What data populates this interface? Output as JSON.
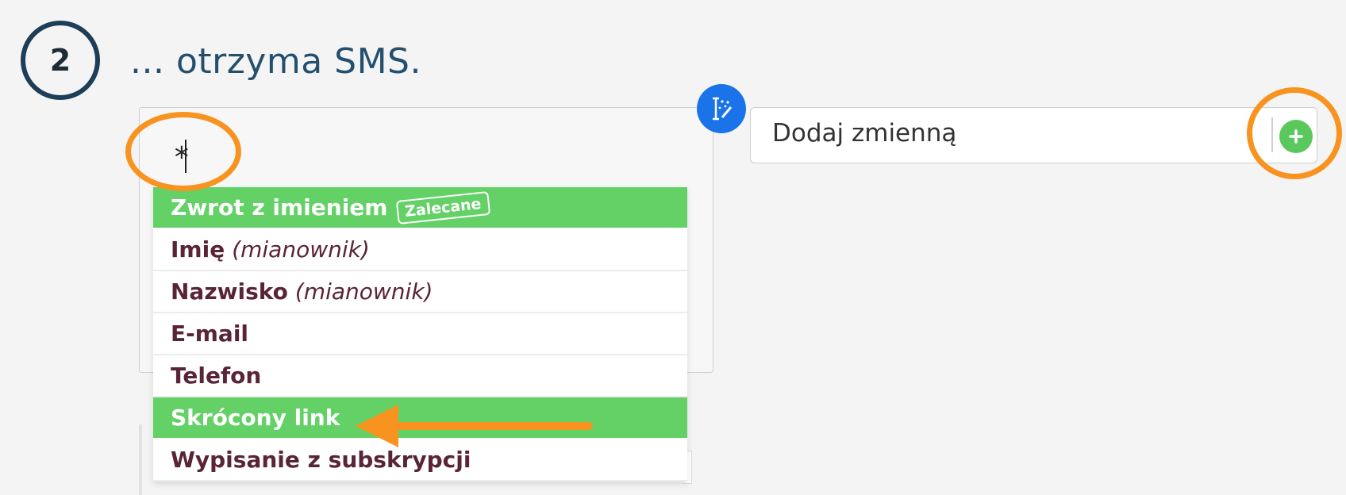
{
  "step": {
    "number": "2",
    "title": "... otrzyma SMS."
  },
  "message": {
    "text": "*"
  },
  "variable_input": {
    "placeholder": "Dodaj zmienną"
  },
  "dropdown": {
    "items": [
      {
        "label": "Zwrot z imieniem",
        "badge": "Zalecane",
        "highlighted": true
      },
      {
        "label": "Imię",
        "sub": "(mianownik)"
      },
      {
        "label": "Nazwisko",
        "sub": "(mianownik)"
      },
      {
        "label": "E-mail"
      },
      {
        "label": "Telefon"
      },
      {
        "label": "Skrócony link",
        "highlighted": true
      },
      {
        "label": "Wypisanie z subskrypcji"
      }
    ]
  },
  "colors": {
    "highlight": "#63d166",
    "item_text": "#5a2438",
    "annotation": "#f7931e",
    "title": "#24506e",
    "magic_button": "#1a73e8",
    "add_button": "#5bc85e"
  },
  "icons": {
    "magic": "text-cursor-magic-wand-icon",
    "add": "plus-icon",
    "arrow": "arrow-left-icon"
  }
}
